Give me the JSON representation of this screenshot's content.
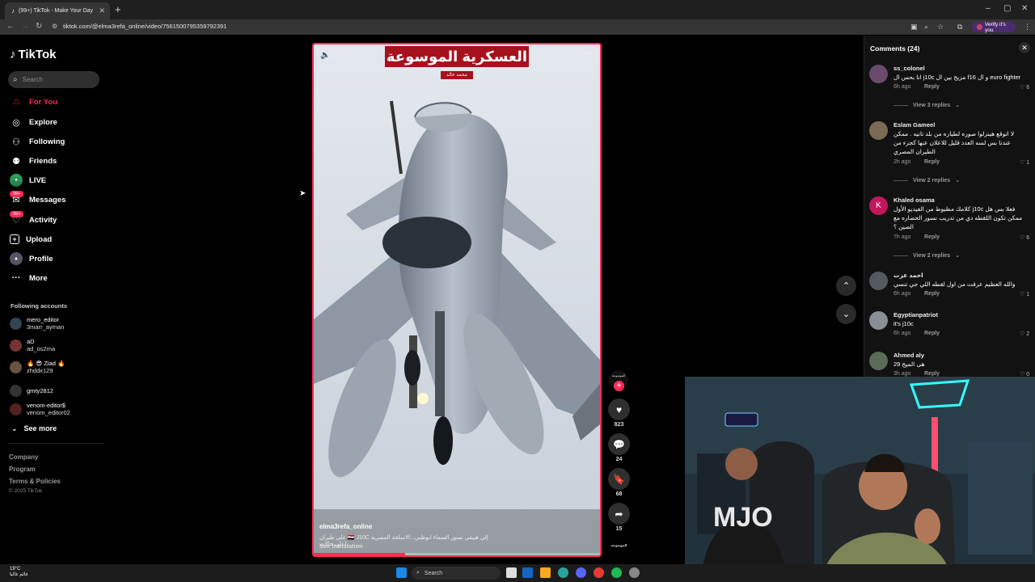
{
  "browser": {
    "tab_title": "(99+) TikTok - Make Your Day",
    "url": "tiktok.com/@elma3refa_online/video/7561500795359792391",
    "verify_label": "Verify it's you"
  },
  "sidebar": {
    "logo": "TikTok",
    "search_placeholder": "Search",
    "nav": [
      {
        "label": "For You",
        "icon": "home-icon"
      },
      {
        "label": "Explore",
        "icon": "compass-icon"
      },
      {
        "label": "Following",
        "icon": "following-icon"
      },
      {
        "label": "Friends",
        "icon": "friends-icon"
      },
      {
        "label": "LIVE",
        "icon": "live-icon"
      },
      {
        "label": "Messages",
        "icon": "messages-icon",
        "badge": "99+"
      },
      {
        "label": "Activity",
        "icon": "activity-icon",
        "badge": "99+"
      },
      {
        "label": "Upload",
        "icon": "upload-icon"
      },
      {
        "label": "Profile",
        "icon": "profile-icon"
      },
      {
        "label": "More",
        "icon": "more-icon"
      }
    ],
    "following_title": "Following accounts",
    "following": [
      {
        "name": "mero_editor",
        "username": "3marr_ayman"
      },
      {
        "name": "aD",
        "username": "ad_os2ma"
      },
      {
        "name": "🔥 😎 Ziad 🔥",
        "username": "zhddx129"
      },
      {
        "name": "gmty2812",
        "username": ""
      },
      {
        "name": "venom-editor$",
        "username": "venom_editor02"
      }
    ],
    "see_more": "See more",
    "footer": [
      "Company",
      "Program",
      "Terms & Policies"
    ],
    "copyright": "© 2025 TikTok"
  },
  "video": {
    "overlay_title": "العسكرية الموسوعة",
    "overlay_sub": "محمد خالد",
    "author": "elma3refa_online",
    "caption": "إلي هيبقى نسور السماء ابوظبي...الاسلحة المصرية 🇪🇬 J10C على طيران اعلى حالات",
    "see_translation": "See translation",
    "progress": 0.32
  },
  "actions": {
    "creator_label": "الموسوعة",
    "likes": "823",
    "comments": "24",
    "saves": "68",
    "shares": "15"
  },
  "comments_panel": {
    "title": "Comments (24)",
    "comments": [
      {
        "user": "ss_colonel",
        "text": "euro fighter و ال f16 مزيج بين ال j10c انا بحس ال",
        "time": "6h ago",
        "reply": "Reply",
        "likes": "6",
        "view_replies": "View 3 replies"
      },
      {
        "user": "Eslam Gameel",
        "text": "لا اتوقع هينزلوا صوره لطياره من بلد تانيه . ممكن عندنا بس لسه العدد قليل للاعلان عنها كجزء من الطيران المصري",
        "time": "2h ago",
        "reply": "Reply",
        "likes": "1",
        "view_replies": "View 2 replies"
      },
      {
        "user": "Khaled osama",
        "text": "فعلا بس هل j10c كلامك مظبوط من الفيديو الأول ممكن تكون اللقطه دي من تدريب نسور الحضاره مع الصين ؟",
        "time": "7h ago",
        "reply": "Reply",
        "likes": "6",
        "view_replies": "View 2 replies",
        "avatar_letter": "K"
      },
      {
        "user": "احمد عزت",
        "text": "والله العظيم عرفت من اول لقطه اللي جي تنسي",
        "time": "6h ago",
        "reply": "Reply",
        "likes": "1"
      },
      {
        "user": "Egyptianpatriot",
        "text": "it's j10c",
        "time": "6h ago",
        "reply": "Reply",
        "likes": "2"
      },
      {
        "user": "Ahmed aly",
        "text": "هى الميج 29",
        "time": "3h ago",
        "reply": "Reply",
        "likes": "0"
      }
    ]
  },
  "taskbar": {
    "temp": "19°C",
    "weather_text": "غائم غالبا",
    "search": "Search"
  },
  "colors": {
    "accent": "#fe2c55",
    "panel": "#121212",
    "background": "#000000"
  }
}
